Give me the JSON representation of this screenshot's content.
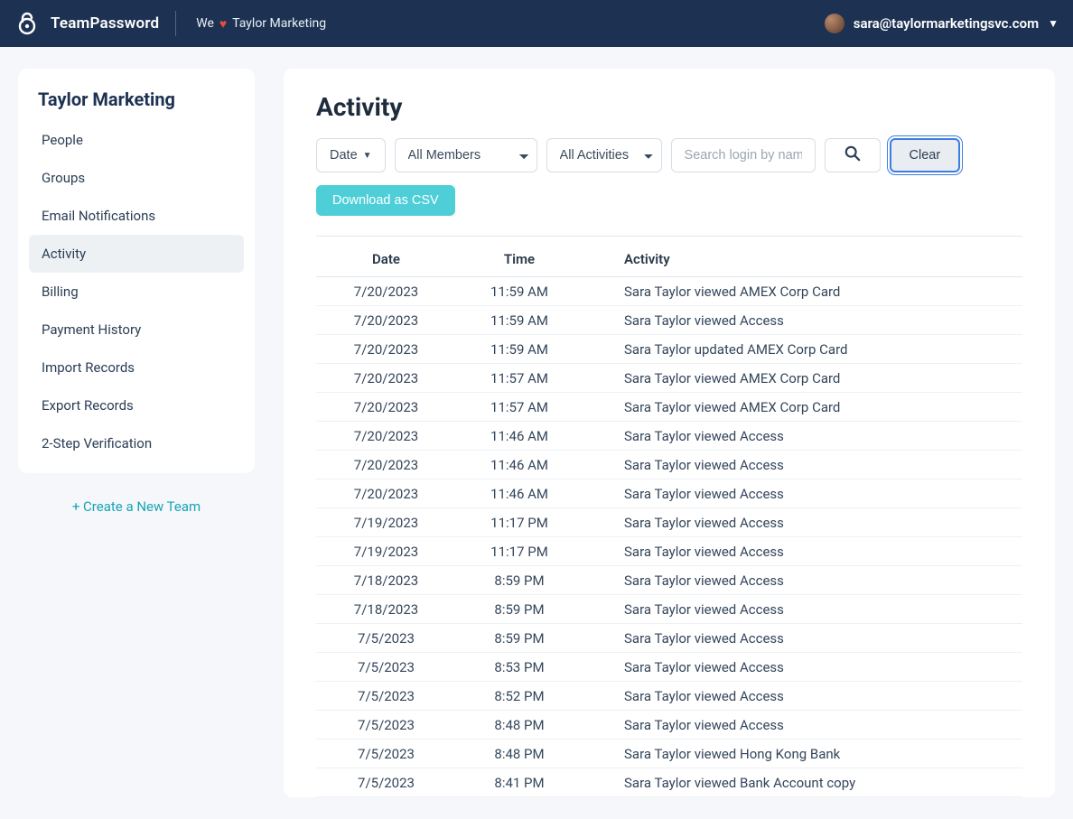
{
  "header": {
    "brand": "TeamPassword",
    "tagline_prefix": "We",
    "tagline_suffix": "Taylor Marketing",
    "user_email": "sara@taylormarketingsvc.com"
  },
  "sidebar": {
    "title": "Taylor Marketing",
    "items": [
      {
        "label": "People",
        "active": false
      },
      {
        "label": "Groups",
        "active": false
      },
      {
        "label": "Email Notifications",
        "active": false
      },
      {
        "label": "Activity",
        "active": true
      },
      {
        "label": "Billing",
        "active": false
      },
      {
        "label": "Payment History",
        "active": false
      },
      {
        "label": "Import Records",
        "active": false
      },
      {
        "label": "Export Records",
        "active": false
      },
      {
        "label": "2-Step Verification",
        "active": false
      }
    ],
    "create_team": "+ Create a New Team"
  },
  "main": {
    "title": "Activity",
    "filters": {
      "date_label": "Date",
      "members_selected": "All Members",
      "activities_selected": "All Activities",
      "search_placeholder": "Search login by name",
      "clear_label": "Clear",
      "csv_label": "Download as CSV"
    },
    "columns": {
      "date": "Date",
      "time": "Time",
      "activity": "Activity"
    },
    "rows": [
      {
        "date": "7/20/2023",
        "time": "11:59 AM",
        "activity": "Sara Taylor viewed AMEX Corp Card"
      },
      {
        "date": "7/20/2023",
        "time": "11:59 AM",
        "activity": "Sara Taylor viewed Access"
      },
      {
        "date": "7/20/2023",
        "time": "11:59 AM",
        "activity": "Sara Taylor updated AMEX Corp Card"
      },
      {
        "date": "7/20/2023",
        "time": "11:57 AM",
        "activity": "Sara Taylor viewed AMEX Corp Card"
      },
      {
        "date": "7/20/2023",
        "time": "11:57 AM",
        "activity": "Sara Taylor viewed AMEX Corp Card"
      },
      {
        "date": "7/20/2023",
        "time": "11:46 AM",
        "activity": "Sara Taylor viewed Access"
      },
      {
        "date": "7/20/2023",
        "time": "11:46 AM",
        "activity": "Sara Taylor viewed Access"
      },
      {
        "date": "7/20/2023",
        "time": "11:46 AM",
        "activity": "Sara Taylor viewed Access"
      },
      {
        "date": "7/19/2023",
        "time": "11:17 PM",
        "activity": "Sara Taylor viewed Access"
      },
      {
        "date": "7/19/2023",
        "time": "11:17 PM",
        "activity": "Sara Taylor viewed Access"
      },
      {
        "date": "7/18/2023",
        "time": "8:59 PM",
        "activity": "Sara Taylor viewed Access"
      },
      {
        "date": "7/18/2023",
        "time": "8:59 PM",
        "activity": "Sara Taylor viewed Access"
      },
      {
        "date": "7/5/2023",
        "time": "8:59 PM",
        "activity": "Sara Taylor viewed Access"
      },
      {
        "date": "7/5/2023",
        "time": "8:53 PM",
        "activity": "Sara Taylor viewed Access"
      },
      {
        "date": "7/5/2023",
        "time": "8:52 PM",
        "activity": "Sara Taylor viewed Access"
      },
      {
        "date": "7/5/2023",
        "time": "8:48 PM",
        "activity": "Sara Taylor viewed Access"
      },
      {
        "date": "7/5/2023",
        "time": "8:48 PM",
        "activity": "Sara Taylor viewed Hong Kong Bank"
      },
      {
        "date": "7/5/2023",
        "time": "8:41 PM",
        "activity": "Sara Taylor viewed Bank Account copy"
      }
    ]
  }
}
